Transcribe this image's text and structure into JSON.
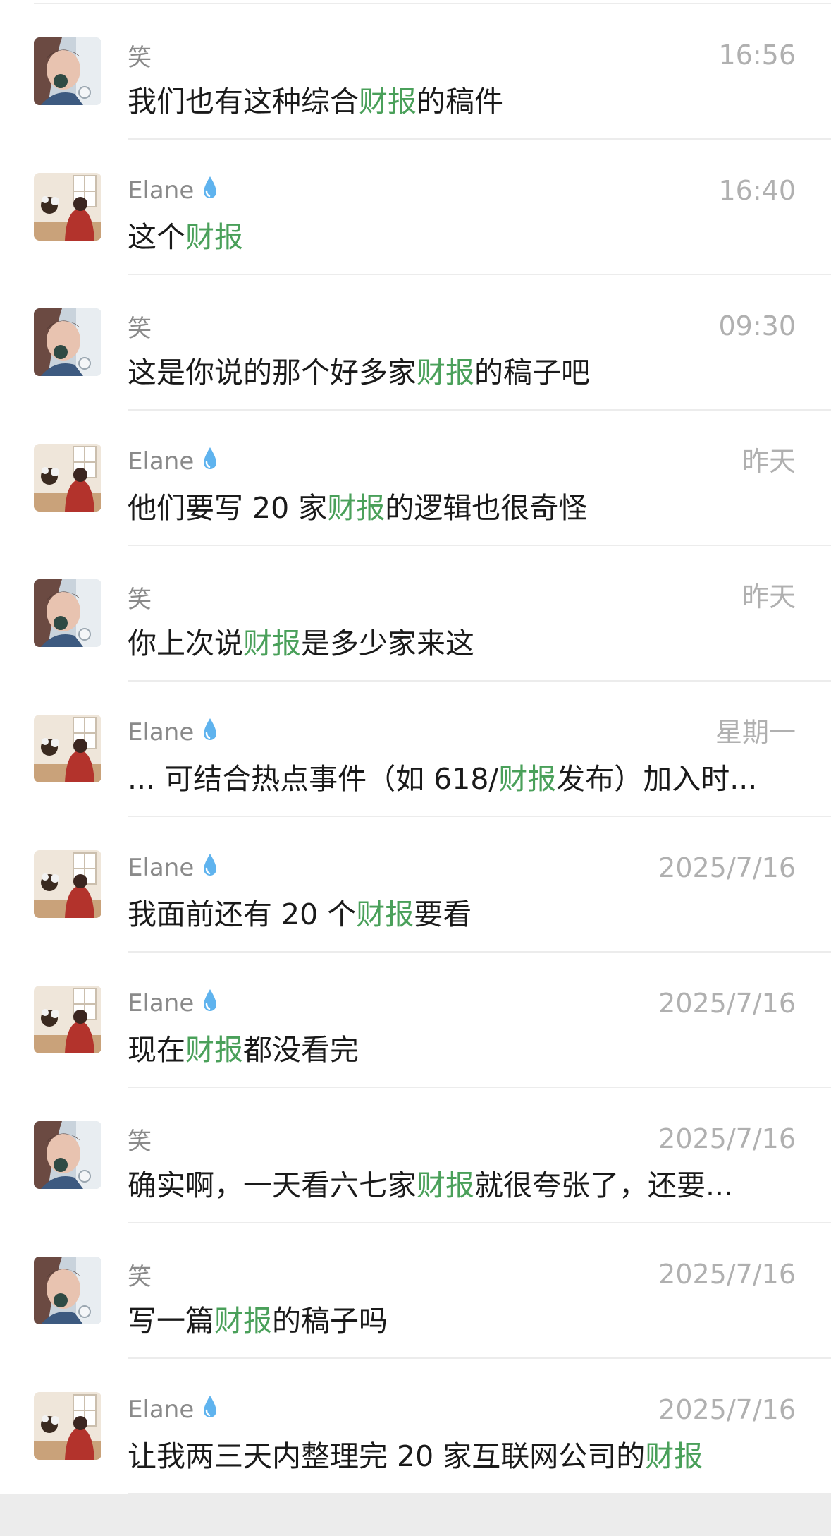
{
  "highlight_color": "#4aa05a",
  "results": [
    {
      "sender": "笑",
      "avatar": "avatar-xiao",
      "has_drop": false,
      "time": "16:56",
      "before": "我们也有这种综合",
      "keyword": "财报",
      "after": "的稿件"
    },
    {
      "sender": "Elane",
      "avatar": "avatar-elane",
      "has_drop": true,
      "time": "16:40",
      "before": "这个",
      "keyword": "财报",
      "after": ""
    },
    {
      "sender": "笑",
      "avatar": "avatar-xiao",
      "has_drop": false,
      "time": "09:30",
      "before": "这是你说的那个好多家",
      "keyword": "财报",
      "after": "的稿子吧"
    },
    {
      "sender": "Elane",
      "avatar": "avatar-elane",
      "has_drop": true,
      "time": "昨天",
      "before": "他们要写 20 家",
      "keyword": "财报",
      "after": "的逻辑也很奇怪"
    },
    {
      "sender": "笑",
      "avatar": "avatar-xiao",
      "has_drop": false,
      "time": "昨天",
      "before": "你上次说",
      "keyword": "财报",
      "after": "是多少家来这"
    },
    {
      "sender": "Elane",
      "avatar": "avatar-elane",
      "has_drop": true,
      "time": "星期一",
      "before": "... 可结合热点事件（如 618/",
      "keyword": "财报",
      "after": "发布）加入时..."
    },
    {
      "sender": "Elane",
      "avatar": "avatar-elane",
      "has_drop": true,
      "time": "2025/7/16",
      "before": "我面前还有 20 个",
      "keyword": "财报",
      "after": "要看"
    },
    {
      "sender": "Elane",
      "avatar": "avatar-elane",
      "has_drop": true,
      "time": "2025/7/16",
      "before": "现在",
      "keyword": "财报",
      "after": "都没看完"
    },
    {
      "sender": "笑",
      "avatar": "avatar-xiao",
      "has_drop": false,
      "time": "2025/7/16",
      "before": "确实啊，一天看六七家",
      "keyword": "财报",
      "after": "就很夸张了，还要..."
    },
    {
      "sender": "笑",
      "avatar": "avatar-xiao",
      "has_drop": false,
      "time": "2025/7/16",
      "before": "写一篇",
      "keyword": "财报",
      "after": "的稿子吗"
    },
    {
      "sender": "Elane",
      "avatar": "avatar-elane",
      "has_drop": true,
      "time": "2025/7/16",
      "before": "让我两三天内整理完 20 家互联网公司的",
      "keyword": "财报",
      "after": ""
    }
  ]
}
